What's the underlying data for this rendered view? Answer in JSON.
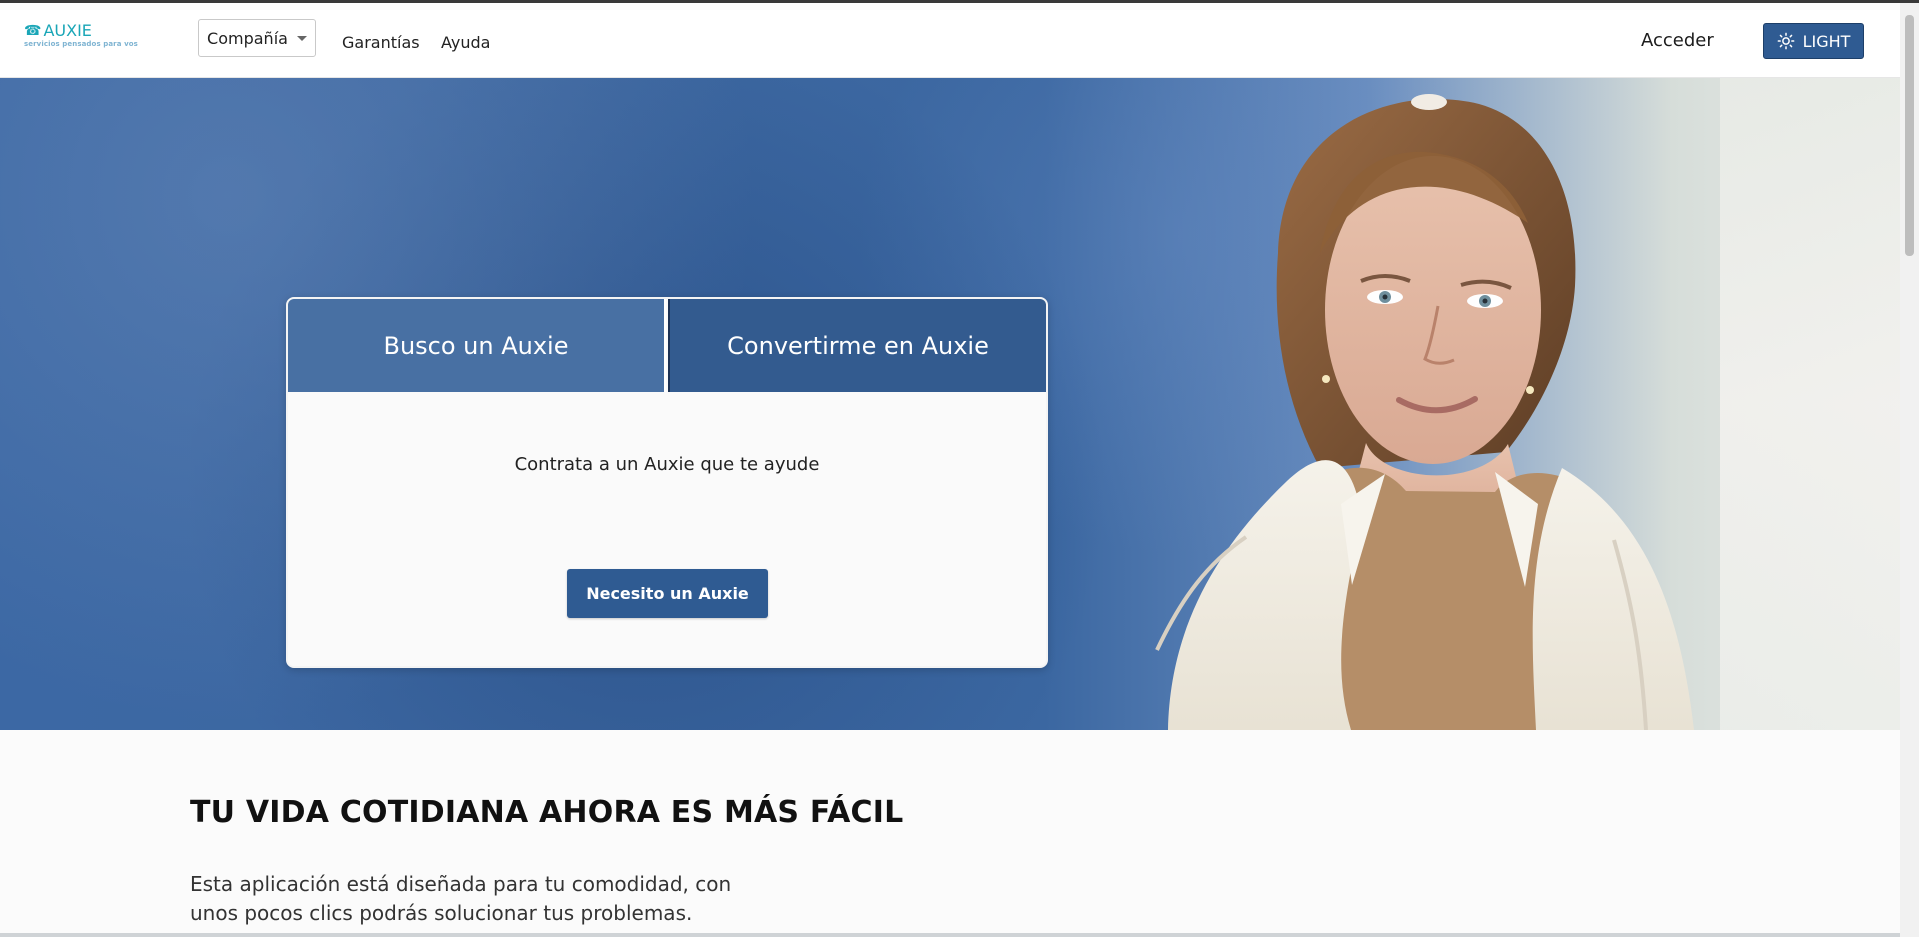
{
  "header": {
    "logo_text": "AUXIE",
    "logo_tagline": "servicios pensados para vos",
    "company_menu_label": "Compañía",
    "nav_links": [
      "Garantías",
      "Ayuda"
    ],
    "login_label": "Acceder",
    "theme_label": "LIGHT"
  },
  "hero": {
    "tabs": [
      "Busco un Auxie",
      "Convertirme en Auxie"
    ],
    "active_tab_description": "Contrata a un Auxie que te ayude",
    "primary_button": "Necesito un Auxie"
  },
  "section": {
    "title": "TU VIDA COTIDIANA AHORA ES MÁS FÁCIL",
    "copy": "Esta aplicación está diseñada para tu comodidad, con unos pocos clics podrás solucionar tus problemas."
  },
  "icons": {
    "logo_phone": "phone-icon",
    "company_caret": "chevron-down-icon",
    "theme": "sun-icon"
  },
  "colors": {
    "accent": "#2f5b92",
    "logo": "#1aa6b7",
    "tab_light": "#4870a3",
    "tab_dark": "#335b8f"
  }
}
